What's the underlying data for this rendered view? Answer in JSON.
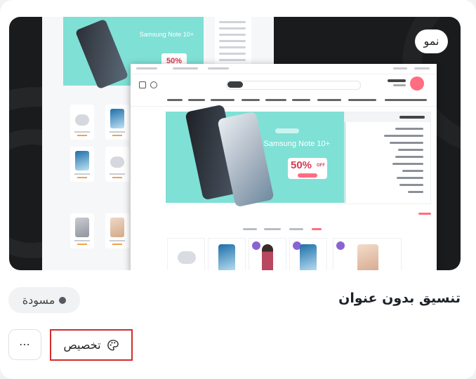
{
  "card": {
    "title": "تنسيق بدون عنوان",
    "status_label": "مسودة",
    "brand_badge": "نمو",
    "customize_label": "تخصيص",
    "more_icon": "⋯"
  },
  "preview": {
    "back_hero_title": "Samsung Note 10+",
    "back_hero_discount": "50%",
    "front_hero_title": "Samsung Note 10+",
    "front_hero_discount": "50%",
    "front_hero_off": "OFF"
  },
  "colors": {
    "highlight_border": "#d42b2b",
    "hero_bg": "#7fe0d6",
    "accent_pink": "#ff6d82",
    "dark_preview_bg": "#1a1b1d"
  },
  "icons": {
    "palette": "palette-icon",
    "more": "more-icon",
    "status": "status-dot"
  }
}
